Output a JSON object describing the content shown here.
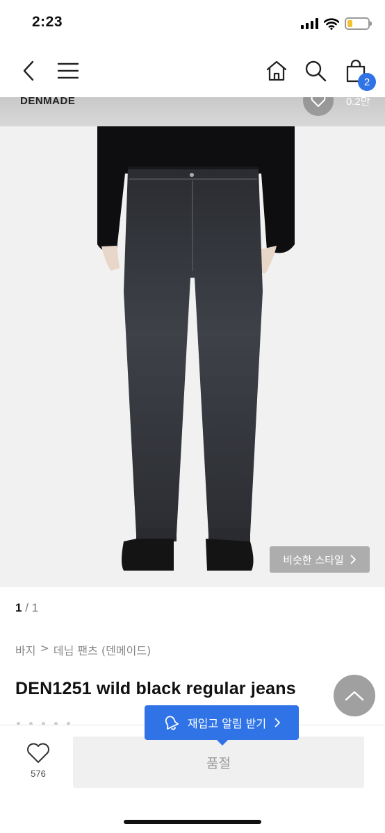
{
  "status_bar": {
    "time": "2:23",
    "icons": [
      "signal-icon",
      "wifi-icon",
      "battery-icon"
    ],
    "battery_level": 0.25,
    "battery_color": "#f2c230"
  },
  "nav": {
    "icons": [
      "back-icon",
      "menu-icon",
      "home-icon",
      "search-icon",
      "cart-icon"
    ],
    "cart_count": "2",
    "badge_color": "#2f73e6"
  },
  "product_image": {
    "brand": "DENMADE",
    "like_count": "0.2만",
    "similar_style_label": "비슷한 스타일",
    "current_page": "1",
    "page_separator": "/",
    "total_pages": "1"
  },
  "breadcrumb": {
    "category": "바지",
    "separator": ">",
    "subcategory": "데님 팬츠 (덴메이드)"
  },
  "product": {
    "title": "DEN1251 wild black regular jeans"
  },
  "restock": {
    "label": "재입고 알림 받기"
  },
  "bottom_bar": {
    "wish_count": "576",
    "soldout_label": "품절"
  },
  "colors": {
    "accent": "#2f73e6",
    "soldout_bg": "#f0f0f0"
  }
}
